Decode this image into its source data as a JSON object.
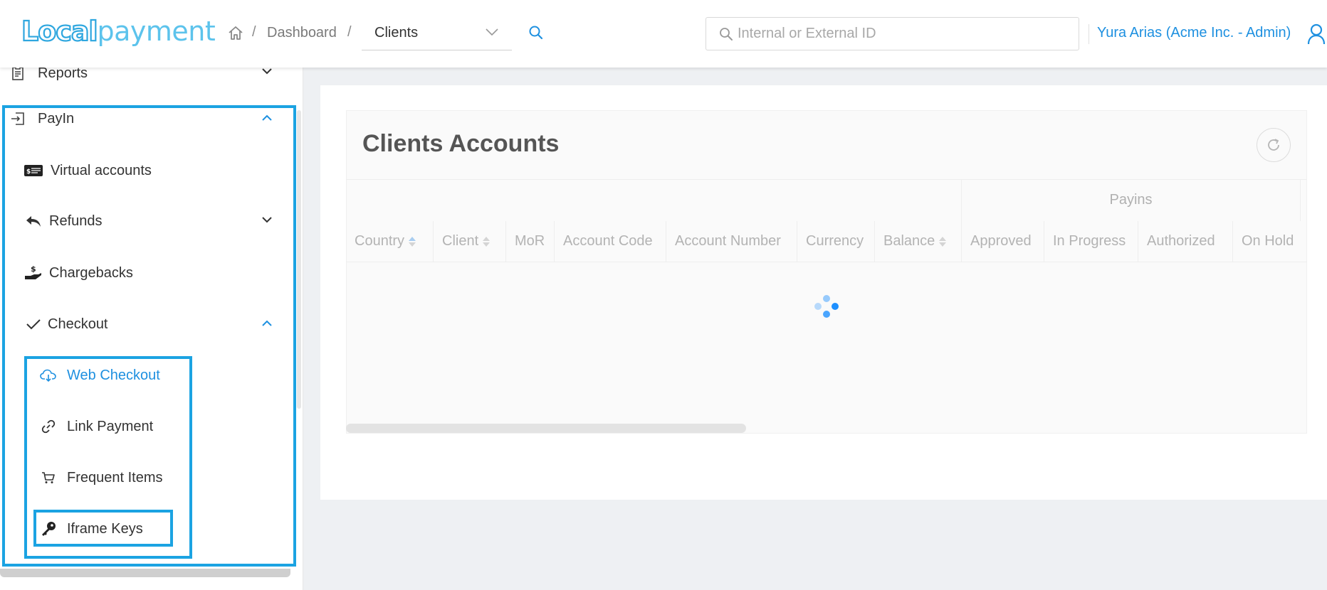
{
  "header": {
    "logo_part1": "Local",
    "logo_part2": "payment",
    "breadcrumb": {
      "separator": "/",
      "dashboard": "Dashboard",
      "current_select": "Clients"
    },
    "search": {
      "placeholder": "Internal or External ID",
      "value": ""
    },
    "user_name": "Yura Arias (Acme Inc. - Admin)"
  },
  "sidebar": {
    "items": [
      {
        "label": "Reports",
        "icon": "reports-icon",
        "chevron": "down"
      },
      {
        "label": "PayIn",
        "icon": "payin-icon",
        "chevron": "up"
      },
      {
        "label": "Virtual accounts",
        "icon": "virtual-accounts-icon"
      },
      {
        "label": "Refunds",
        "icon": "refunds-icon",
        "chevron": "down"
      },
      {
        "label": "Chargebacks",
        "icon": "chargebacks-icon"
      },
      {
        "label": "Checkout",
        "icon": "checkmark-icon",
        "chevron": "up"
      }
    ],
    "checkout_subitems": [
      {
        "label": "Web Checkout",
        "icon": "cloud-download-icon",
        "active": true
      },
      {
        "label": "Link Payment",
        "icon": "link-icon"
      },
      {
        "label": "Frequent Items",
        "icon": "cart-icon"
      },
      {
        "label": "Iframe Keys",
        "icon": "key-icon"
      }
    ]
  },
  "main": {
    "title": "Clients Accounts",
    "group_header": "Payins",
    "columns": [
      {
        "label": "Country",
        "sortable": true,
        "sort": "asc"
      },
      {
        "label": "Client",
        "sortable": true
      },
      {
        "label": "MoR"
      },
      {
        "label": "Account Code"
      },
      {
        "label": "Account Number"
      },
      {
        "label": "Currency"
      },
      {
        "label": "Balance",
        "sortable": true
      },
      {
        "label": "Approved"
      },
      {
        "label": "In Progress"
      },
      {
        "label": "Authorized"
      },
      {
        "label": "On Hold"
      }
    ],
    "loading": true
  },
  "colors": {
    "accent": "#1e90e0",
    "highlight_border": "#1ba3e2",
    "logo_dark": "#2fa7df",
    "logo_light": "#5cc3ec"
  }
}
